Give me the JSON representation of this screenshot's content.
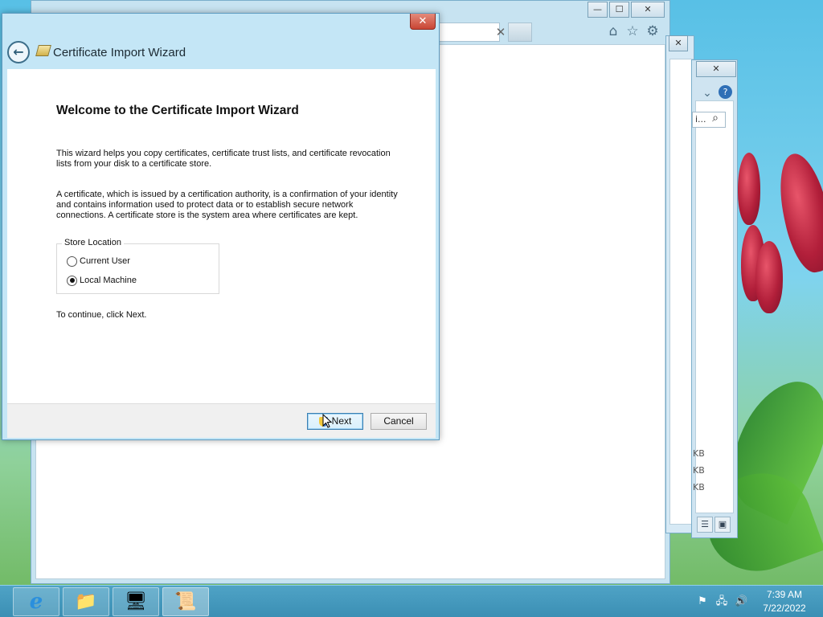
{
  "wizard": {
    "window_title": "Certificate Import Wizard",
    "close_glyph": "✕",
    "back_glyph": "←",
    "heading": "Welcome to the Certificate Import Wizard",
    "intro_line1": "This wizard helps you copy certificates, certificate trust lists, and certificate revocation",
    "intro_line2": "lists from your disk to a certificate store.",
    "desc_line1": "A certificate, which is issued by a certification authority, is a confirmation of your identity",
    "desc_line2": "and contains information used to protect data or to establish secure network",
    "desc_line3": "connections. A certificate store is the system area where certificates are kept.",
    "store_location": {
      "legend": "Store Location",
      "options": [
        {
          "label": "Current User",
          "selected": false
        },
        {
          "label": "Local Machine",
          "selected": true
        }
      ]
    },
    "continue_text": "To continue, click Next.",
    "next_label": "Next",
    "cancel_label": "Cancel"
  },
  "ie_window": {
    "minimize_glyph": "—",
    "maximize_glyph": "☐",
    "close_glyph": "✕",
    "tab_close_glyph": "✕",
    "toolbar_icons": [
      "home-icon",
      "favorites-star-icon",
      "tools-gear-icon"
    ],
    "toolbar_glyphs": {
      "home": "⌂",
      "star": "☆",
      "gear": "⚙"
    }
  },
  "explorer_window": {
    "close_glyph": "✕"
  },
  "cert_manager_window": {
    "close_glyph": "✕",
    "expand_glyph": "⌄",
    "help_glyph": "?",
    "search_text": "i...",
    "search_glyph": "⌕",
    "size_labels": [
      "KB",
      "KB",
      "KB"
    ]
  },
  "taskbar": {
    "apps": [
      {
        "name": "internet-explorer",
        "glyph": "e"
      },
      {
        "name": "file-explorer",
        "glyph": "📁"
      },
      {
        "name": "server-manager",
        "glyph": "🖥"
      },
      {
        "name": "certificate-manager",
        "glyph": "📜"
      }
    ],
    "tray": {
      "flag_glyph": "⚑",
      "network_glyph": "🖧",
      "volume_glyph": "🔊"
    },
    "clock": {
      "time": "7:39 AM",
      "date": "7/22/2022"
    }
  },
  "colors": {
    "accent": "#3c7fb1",
    "title_bar": "#c4e6f6",
    "close_red": "#c94534",
    "taskbar": "#3b8fb4"
  }
}
